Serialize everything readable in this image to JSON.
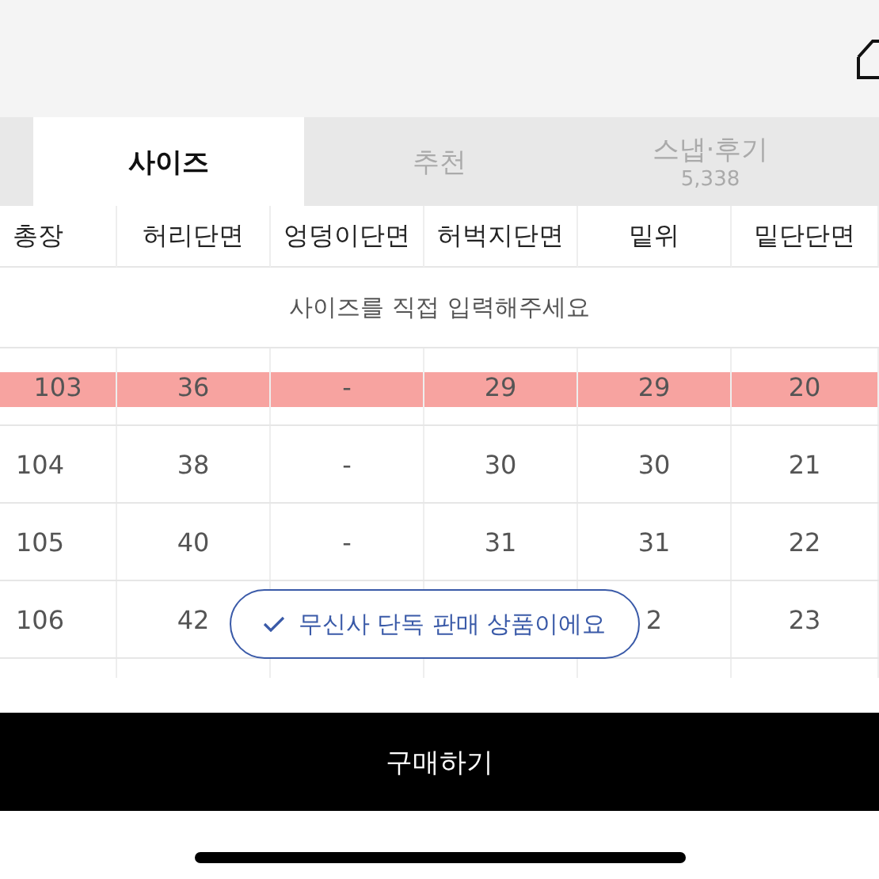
{
  "tabs": [
    {
      "label": "사이즈",
      "selected": true
    },
    {
      "label": "추천",
      "selected": false
    },
    {
      "label": "스냅·후기",
      "count": "5,338",
      "selected": false
    }
  ],
  "table": {
    "columns": [
      "총장",
      "허리단면",
      "엉덩이단면",
      "허벅지단면",
      "밑위",
      "밑단단면"
    ],
    "input_prompt": "사이즈를 직접 입력해주세요",
    "rows": [
      {
        "cells": [
          "103",
          "36",
          "-",
          "29",
          "29",
          "20"
        ],
        "highlighted": true
      },
      {
        "cells": [
          "104",
          "38",
          "-",
          "30",
          "30",
          "21"
        ],
        "highlighted": false
      },
      {
        "cells": [
          "105",
          "40",
          "-",
          "31",
          "31",
          "22"
        ],
        "highlighted": false
      },
      {
        "cells": [
          "106",
          "42",
          null,
          null,
          "2",
          "23"
        ],
        "highlighted": false
      }
    ]
  },
  "toast": {
    "text": "무신사 단독 판매 상품이에요"
  },
  "buy_button": "구매하기"
}
